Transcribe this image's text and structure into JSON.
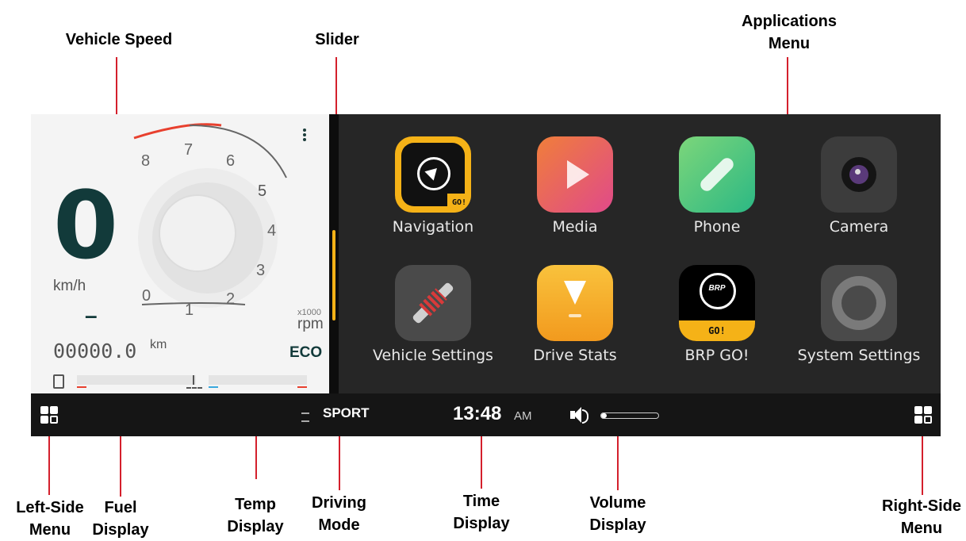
{
  "callouts": {
    "vehicle_speed": "Vehicle Speed",
    "slider": "Slider",
    "applications_menu": "Applications Menu",
    "left_side_menu": "Left-Side Menu",
    "fuel_display": "Fuel Display",
    "temp_display": "Temp Display",
    "driving_mode": "Driving Mode",
    "time_display": "Time Display",
    "volume_display": "Volume Display",
    "right_side_menu": "Right-Side Menu"
  },
  "cluster": {
    "speed_value": "0",
    "speed_unit": "km/h",
    "gear": "–",
    "rpm_ticks": [
      "0",
      "1",
      "2",
      "3",
      "4",
      "5",
      "6",
      "7",
      "8"
    ],
    "rpm_multiplier": "x1000",
    "rpm_unit": "rpm",
    "odometer": "00000.0",
    "odometer_unit": "km",
    "eco_label": "ECO",
    "colors": {
      "redline": "#e8402e",
      "speed_digit": "#123a3a",
      "eco": "#123a3a"
    }
  },
  "apps": [
    {
      "label": "Navigation",
      "icon": "navigation-compass-icon",
      "badge": "GO!"
    },
    {
      "label": "Media",
      "icon": "media-play-icon"
    },
    {
      "label": "Phone",
      "icon": "phone-handset-icon"
    },
    {
      "label": "Camera",
      "icon": "camera-lens-icon"
    },
    {
      "label": "Vehicle Settings",
      "icon": "suspension-shock-icon"
    },
    {
      "label": "Drive Stats",
      "icon": "drive-stats-icon"
    },
    {
      "label": "BRP GO!",
      "icon": "brp-logo-icon",
      "badge": "GO!",
      "logo_text": "BRP"
    },
    {
      "label": "System Settings",
      "icon": "gear-icon"
    }
  ],
  "bottombar": {
    "drive_mode": "SPORT",
    "time": "13:48",
    "ampm": "AM",
    "volume_level": 0.1,
    "accent_color": "#f5b217"
  }
}
